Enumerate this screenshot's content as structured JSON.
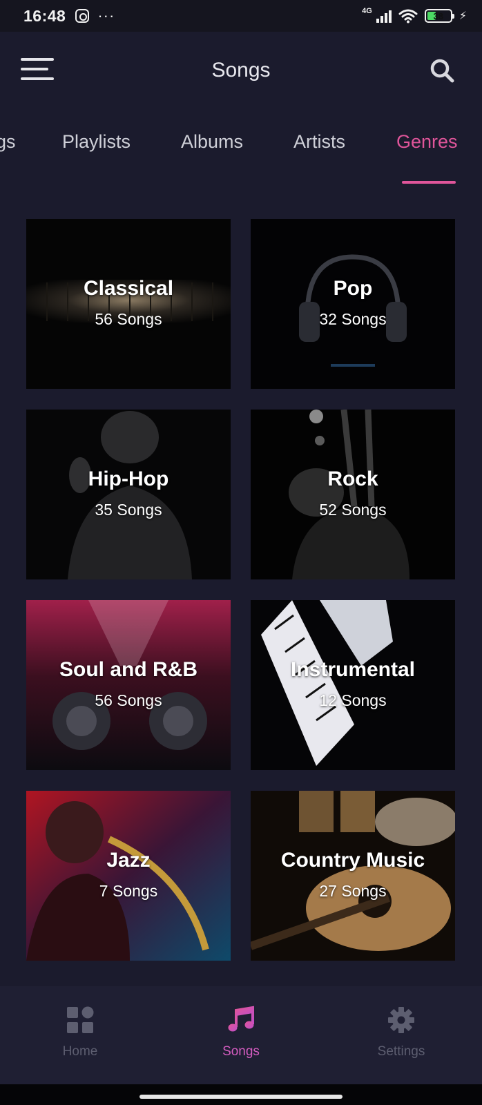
{
  "status_bar": {
    "time": "16:48",
    "network": "4G",
    "battery": "38",
    "battery_level": 0.38,
    "icons": [
      "instagram-icon",
      "more-dots-icon",
      "signal-icon",
      "wifi-icon",
      "battery-icon",
      "charging-bolt-icon"
    ],
    "more": "···",
    "bolt": "⚡"
  },
  "header": {
    "title": "Songs",
    "menu_icon": "hamburger-menu-icon",
    "search_icon": "search-icon"
  },
  "tabs": [
    {
      "label": "gs",
      "active": false
    },
    {
      "label": "Playlists",
      "active": false
    },
    {
      "label": "Albums",
      "active": false
    },
    {
      "label": "Artists",
      "active": false
    },
    {
      "label": "Genres",
      "active": true
    }
  ],
  "genres": [
    {
      "name": "Classical",
      "count": "56 Songs"
    },
    {
      "name": "Pop",
      "count": "32 Songs"
    },
    {
      "name": "Hip-Hop",
      "count": "35 Songs"
    },
    {
      "name": "Rock",
      "count": "52 Songs"
    },
    {
      "name": "Soul and R&B",
      "count": "56 Songs"
    },
    {
      "name": "Instrumental",
      "count": "12 Songs"
    },
    {
      "name": "Jazz",
      "count": "7 Songs"
    },
    {
      "name": "Country Music",
      "count": "27 Songs"
    }
  ],
  "bottom_nav": [
    {
      "label": "Home",
      "icon": "grid-icon",
      "active": false
    },
    {
      "label": "Songs",
      "icon": "music-note-icon",
      "active": true
    },
    {
      "label": "Settings",
      "icon": "gear-icon",
      "active": false
    }
  ],
  "colors": {
    "background": "#1b1b2d",
    "accent_pink": "#e0559a",
    "nav_active": "#d45cc0",
    "nav_inactive": "#5d5e70"
  }
}
